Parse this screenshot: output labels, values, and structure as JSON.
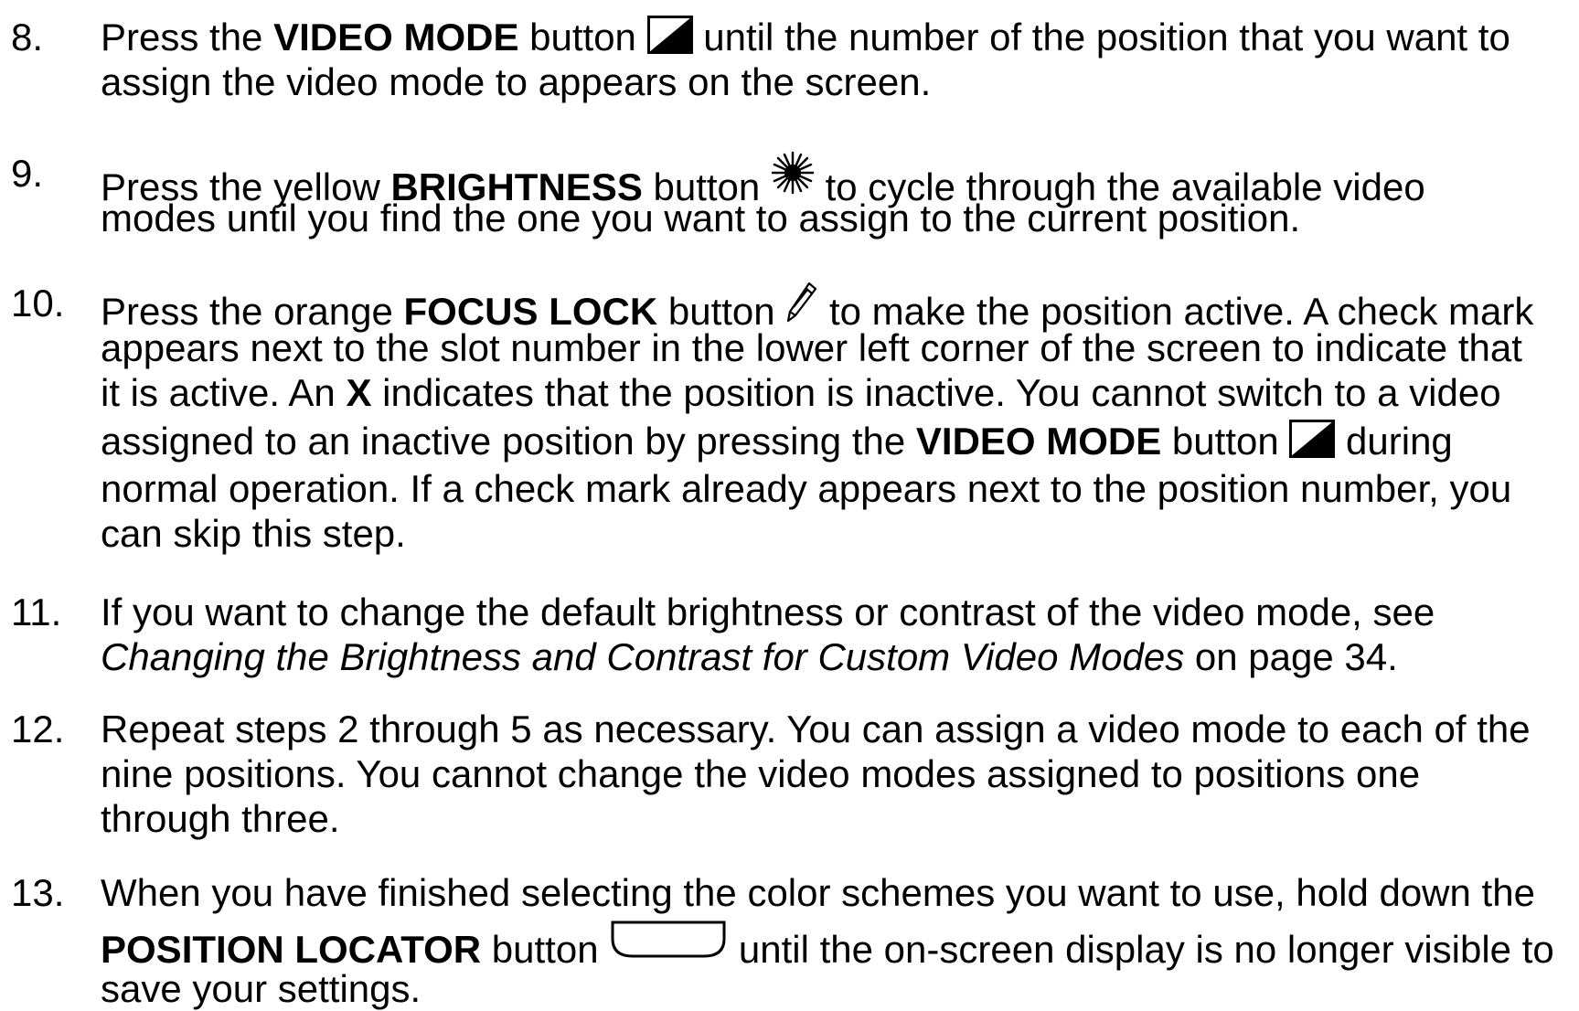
{
  "steps": [
    {
      "number": "8.",
      "lines": [
        {
          "a": "Press the ",
          "b": "VIDEO MODE",
          "c": " button ",
          "icon": "video-mode-icon",
          "d": " until the number of the position that you want to"
        },
        {
          "a": "assign the video mode to appears on the screen."
        }
      ]
    },
    {
      "number": "9.",
      "lines": [
        {
          "a": "Press the yellow ",
          "b": "BRIGHTNESS",
          "c": " button ",
          "icon": "brightness-icon",
          "d": " to cycle through the available video"
        },
        {
          "a": "modes until you find the one you want to assign to the current position."
        }
      ]
    },
    {
      "number": "10.",
      "lines": [
        {
          "a": "Press the orange ",
          "b": "FOCUS LOCK",
          "c": " button ",
          "icon": "focus-lock-icon",
          "d": " to make the position active. A check mark"
        },
        {
          "a": "appears next to the slot number in the lower left corner of the screen to indicate that"
        },
        {
          "a": "it is active. An ",
          "b": "X",
          "c": " indicates that the position is inactive. You cannot switch to a video"
        },
        {
          "a": "assigned to an inactive position by pressing the ",
          "b": "VIDEO MODE",
          "c": " button ",
          "icon": "video-mode-icon",
          "d": " during"
        },
        {
          "a": "normal operation. If a check mark already appears next to the position number, you"
        },
        {
          "a": "can skip this step."
        }
      ]
    },
    {
      "number": "11.",
      "lines": [
        {
          "a": "If you want to change the default brightness or contrast of the video mode, see"
        },
        {
          "i": "Changing the Brightness and Contrast for Custom Video Modes",
          "a": " on page 34."
        }
      ]
    },
    {
      "number": "12.",
      "lines": [
        {
          "a": "Repeat steps 2 through 5 as necessary. You can assign a video mode to each of the"
        },
        {
          "a": "nine positions. You cannot change the video modes assigned to positions one"
        },
        {
          "a": "through three."
        }
      ]
    },
    {
      "number": "13.",
      "lines": [
        {
          "a": "When you have finished selecting the color schemes you want to use, hold down the"
        },
        {
          "b": "POSITION LOCATOR",
          "c": " button ",
          "icon": "position-locator-icon",
          "d": " until the on-screen display is no longer visible to"
        },
        {
          "a": "save your settings."
        }
      ]
    }
  ]
}
